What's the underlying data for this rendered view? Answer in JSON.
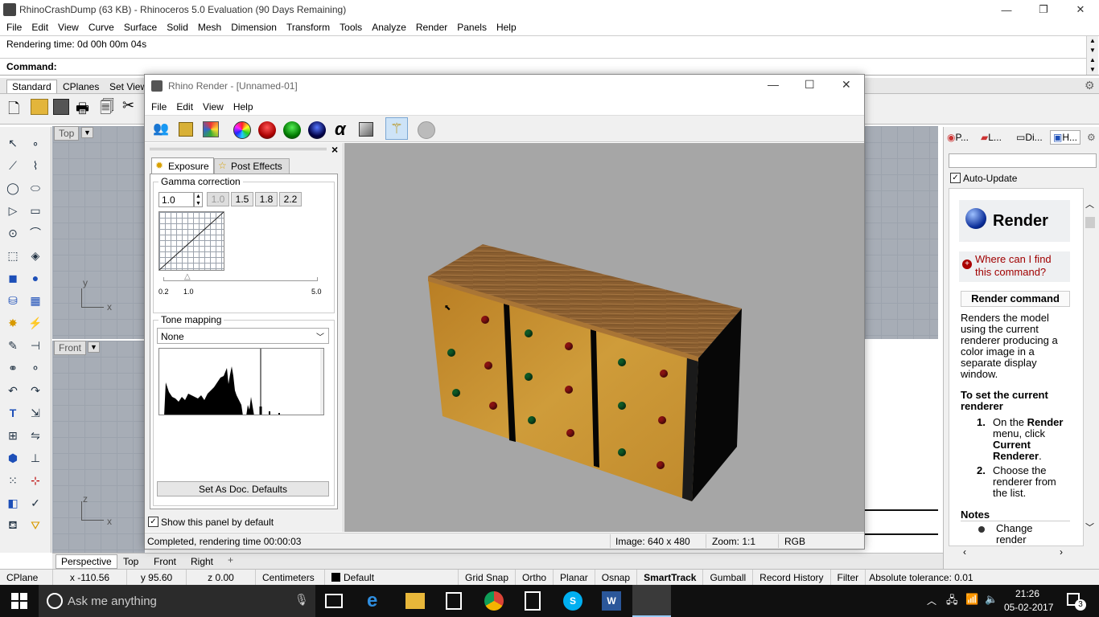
{
  "main_window": {
    "title": "RhinoCrashDump (63 KB) - Rhinoceros 5.0 Evaluation (90 Days Remaining)",
    "menu": [
      "File",
      "Edit",
      "View",
      "Curve",
      "Surface",
      "Solid",
      "Mesh",
      "Dimension",
      "Transform",
      "Tools",
      "Analyze",
      "Render",
      "Panels",
      "Help"
    ],
    "history_line": "Rendering time: 0d 00h 00m 04s",
    "command_label": "Command:",
    "toolbar_tabs": [
      "Standard",
      "CPlanes",
      "Set View"
    ]
  },
  "viewports": {
    "top_label": "Top",
    "front_label": "Front",
    "bottom_tabs": [
      "Perspective",
      "Top",
      "Front",
      "Right"
    ],
    "add_tab": "+"
  },
  "render_window": {
    "title": "Rhino Render - [Unnamed-01]",
    "menu": [
      "File",
      "Edit",
      "View",
      "Help"
    ],
    "panel_close": "×",
    "tabs": [
      "Exposure",
      "Post Effects"
    ],
    "gamma": {
      "legend": "Gamma correction",
      "value": "1.0",
      "presets": [
        "1.0",
        "1.5",
        "1.8",
        "2.2"
      ],
      "slider_min": "0.2",
      "slider_mid": "1.0",
      "slider_max": "5.0"
    },
    "tone": {
      "legend": "Tone mapping",
      "selected": "None"
    },
    "set_defaults_button": "Set As Doc. Defaults",
    "show_panel_checkbox": "Show this panel by default",
    "status": {
      "text": "Completed, rendering time 00:00:03",
      "image": "Image: 640 x 480",
      "zoom": "Zoom: 1:1",
      "mode": "RGB"
    }
  },
  "right_panel": {
    "tabs": [
      "P...",
      "L...",
      "Di...",
      "H..."
    ],
    "auto_update": "Auto-Update",
    "help_title": "Render",
    "where_link": "Where can I find this command?",
    "section_title": "Render command",
    "description": "Renders the model using the current renderer producing a color image in a separate display window.",
    "sub_heading": "To set the current renderer",
    "steps": [
      {
        "num": "1.",
        "pre": "On the ",
        "bold1": "Render",
        "mid": " menu, click ",
        "bold2": "Current Renderer",
        "post": "."
      },
      {
        "num": "2.",
        "text": "Choose the renderer from the list."
      }
    ],
    "notes_title": "Notes",
    "note_item": "Change render"
  },
  "status_bar": {
    "cplane": "CPlane",
    "x": "x -110.56",
    "y": "y 95.60",
    "z": "z 0.00",
    "units": "Centimeters",
    "layer": "Default",
    "toggles": [
      "Grid Snap",
      "Ortho",
      "Planar",
      "Osnap",
      "SmartTrack",
      "Gumball",
      "Record History",
      "Filter"
    ],
    "tolerance": "Absolute tolerance: 0.01"
  },
  "taskbar": {
    "search_placeholder": "Ask me anything",
    "time": "21:26",
    "date": "05-02-2017",
    "notification_count": "3"
  },
  "colors": {
    "viewport_bg": "#a7adb6",
    "render_bg": "#a6a6a6",
    "wood_top": "#8a5e30",
    "wood_front": "#c8932f",
    "taskbar": "#101010",
    "link_red": "#a00000"
  }
}
